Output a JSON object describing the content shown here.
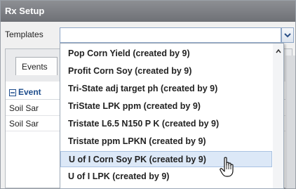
{
  "window": {
    "title": "Rx Setup"
  },
  "templates": {
    "label": "Templates",
    "value": ""
  },
  "tabs": [
    {
      "label": "Events"
    }
  ],
  "events": {
    "header": "Event",
    "rows": [
      "Soil Sar",
      "Soil Sar"
    ]
  },
  "dropdown": {
    "options": [
      "Pop Corn Yield (created by 9)",
      "Profit Corn Soy (created by 9)",
      "Tri-State adj target ph (created by 9)",
      "TriState LPK ppm (created by 9)",
      "Tristate L6.5 N150 P K (created by 9)",
      "Tristate ppm LPKN (created by 9)",
      "U of I Corn Soy PK (created by 9)",
      "U of I LPK (created by 9)"
    ],
    "highlighted": "U of I Corn Soy PK (created by 9)"
  },
  "colors": {
    "accent": "#1e4d8c",
    "highlight": "#dce8f7",
    "titlebar": "#7a7d82"
  }
}
